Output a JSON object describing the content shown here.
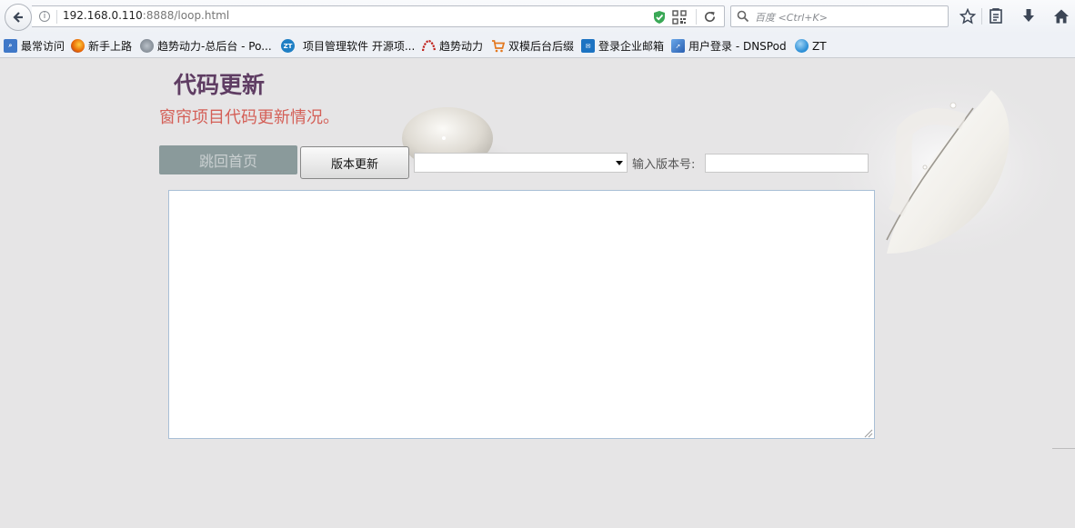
{
  "browser": {
    "url_host": "192.168.0.110",
    "url_rest": ":8888/loop.html",
    "search_placeholder": "百度 <Ctrl+K>"
  },
  "bookmarks": [
    {
      "label": "最常访问",
      "icon": "bookmark-folder-icon",
      "color": "#3f78c8"
    },
    {
      "label": "新手上路",
      "icon": "firefox-icon",
      "color": "#e66000"
    },
    {
      "label": "趋势动力-总后台 - Po...",
      "icon": "globe-icon",
      "color": "#7d8893"
    },
    {
      "label": "项目管理软件 开源项...",
      "icon": "zentao-icon",
      "color": "#1f7fc4"
    },
    {
      "label": "趋势动力",
      "icon": "trend-logo-icon",
      "color": "#c0201a"
    },
    {
      "label": "双模后台后缀",
      "icon": "cart-icon",
      "color": "#e3781f"
    },
    {
      "label": "登录企业邮箱",
      "icon": "mail-icon",
      "color": "#1c73c2"
    },
    {
      "label": "用户登录 - DNSPod",
      "icon": "dnspod-icon",
      "color": "#3a7fd0"
    },
    {
      "label": "ZT",
      "icon": "zt-globe-icon",
      "color": "#2d8fd6"
    }
  ],
  "page": {
    "title": "代码更新",
    "subtitle": "窗帘项目代码更新情况。",
    "home_button": "跳回首页",
    "version_button": "版本更新",
    "version_select_value": "",
    "version_label": "输入版本号:",
    "version_input_value": "",
    "log_text": ""
  },
  "colors": {
    "title": "#5f3d63",
    "subtitle": "#d45f57",
    "home_button_bg": "#8a9a9b",
    "page_bg": "#e6e5e6"
  }
}
